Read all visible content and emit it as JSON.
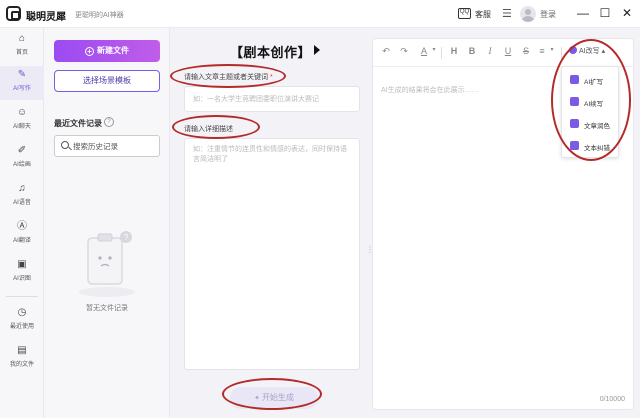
{
  "app": {
    "name": "聪明灵犀",
    "slogan": "更聪明的AI神器",
    "service_label": "客服",
    "service_icon": "QQ",
    "menu_icon": "☰",
    "login_label": "登录",
    "minimize": "—",
    "maximize": "☐",
    "close": "✕"
  },
  "nav": {
    "items": [
      {
        "label": "首页",
        "icon": "⌂",
        "icon_name": "home-icon"
      },
      {
        "label": "AI写作",
        "icon": "✎",
        "icon_name": "pen-icon"
      },
      {
        "label": "AI聊天",
        "icon": "☺",
        "icon_name": "chat-icon"
      },
      {
        "label": "AI绘画",
        "icon": "✐",
        "icon_name": "brush-icon"
      },
      {
        "label": "AI语音",
        "icon": "♫",
        "icon_name": "headphone-icon"
      },
      {
        "label": "AI翻译",
        "icon": "Ⓐ",
        "icon_name": "translate-icon"
      },
      {
        "label": "AI识图",
        "icon": "▣",
        "icon_name": "scan-icon"
      },
      {
        "label": "最近使用",
        "icon": "◷",
        "icon_name": "clock-icon"
      },
      {
        "label": "我的文件",
        "icon": "▤",
        "icon_name": "file-icon"
      }
    ],
    "active_index": 1
  },
  "files": {
    "new_file": "新建文件",
    "choose_template": "选择场景模板",
    "recent_title": "最近文件记录",
    "recent_help": "?",
    "search_placeholder": "搜索历史记录",
    "empty_text": "暂无文件记录"
  },
  "editor": {
    "title": "【剧本创作】",
    "topic_label": "请输入文章主题或者关键词",
    "topic_required": "*",
    "topic_placeholder": "如：一名大学生竞聘团委职位演讲大赛记",
    "detail_label": "请输入详细描述",
    "detail_placeholder": "如：注重情节的连贯性和情感的表达，同时保持语言简洁明了",
    "generate_button": "开始生成",
    "generate_icon": "✦"
  },
  "output": {
    "toolbar": {
      "undo": "↶",
      "redo": "↷",
      "font_color": "A",
      "heading": "H",
      "bold": "B",
      "italic": "I",
      "underline": "U",
      "strike": "S",
      "align": "≡",
      "ai_write": "AI改写"
    },
    "placeholder": "AI生成的结果将会在此展示……",
    "char_count": "0/10000"
  },
  "ai_menu": {
    "items": [
      {
        "label": "AI扩写"
      },
      {
        "label": "AI续写"
      },
      {
        "label": "文章润色"
      },
      {
        "label": "文本纠错"
      }
    ]
  },
  "colors": {
    "accent": "#7b5be3",
    "new_button_start": "#9b4bf2",
    "new_button_end": "#c05de8",
    "annotation": "#b32b28"
  }
}
